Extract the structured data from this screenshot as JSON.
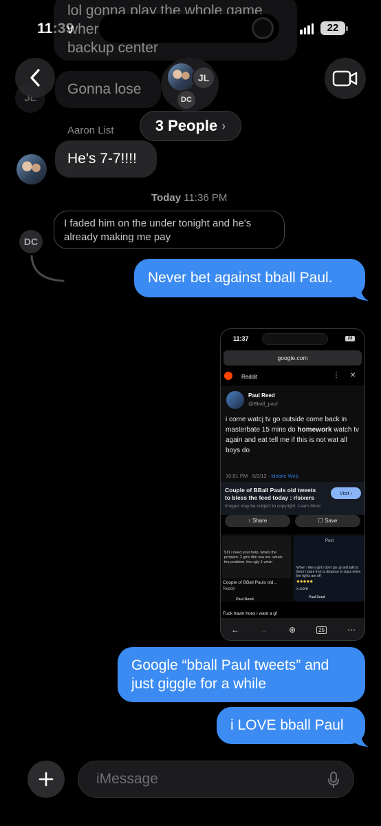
{
  "status": {
    "time": "11:39",
    "battery": "22"
  },
  "header": {
    "back_icon": "chevron-left-icon",
    "video_icon": "video-camera-icon",
    "people_label": "3 People",
    "avatar_initials": [
      "JL",
      "DC"
    ]
  },
  "messages": {
    "m1_text_line1": "lol gonna play the whole game",
    "m1_text_line2": "wher",
    "m1_text_line3": "backup center",
    "m2_text": "Gonna lose",
    "m2_avatar": "JL",
    "sender_aaron": "Aaron List",
    "m3_text": "He's 7-7!!!!",
    "timestamp_day": "Today",
    "timestamp_time": "11:36 PM",
    "m4_text": "I faded him on the under tonight and he's already making me pay",
    "m4_avatar": "DC",
    "m5_text": "Never bet against bball Paul.",
    "m6_text": "Google “bball Paul tweets” and just giggle for a while",
    "m7_text": "i LOVE bball Paul"
  },
  "screenshot": {
    "time": "11:37",
    "battery": "23",
    "url": "google.com",
    "source": "Reddit",
    "tweet_name": "Paul Reed",
    "tweet_handle": "@Bball_paul",
    "tweet_text_a": "i come watcj tv go outside come back in masterbate 15 mins do ",
    "tweet_text_b": "homework",
    "tweet_text_c": " watch tv again and eat tell me if this is not wat all boys do",
    "tweet_meta": "10:51 PM · 9/2/12 · ",
    "tweet_meta_link": "Mobile Web",
    "result_title": "Couple of BBall Pauls old tweets to bless the feed today : r/sixers",
    "result_note": "Images may be subject to copyright. Learn More",
    "visit_label": "Visit ›",
    "share_label": "Share",
    "save_label": "Save",
    "mini1_text": "911 i need your help. whats the problem. 2 girls fitin ova me. whats the problem. the ugly 1 winin",
    "mini1_caption": "Couple of BBall Pauls old...",
    "mini1_source": "Reddit",
    "mini1_name": "Paul Reed",
    "mini1_tweet2": "Fuck havin hoes i want a gf",
    "mini2_header": "Post",
    "mini2_text": "When I like a girl I don't go up and talk to them I stare from a distance in class when the lights are off",
    "mini2_source": "x.com",
    "mini2_name": "Paul Reed",
    "tabs_count": "25"
  },
  "composer": {
    "placeholder": "iMessage",
    "plus_icon": "plus-icon",
    "mic_icon": "microphone-icon"
  }
}
